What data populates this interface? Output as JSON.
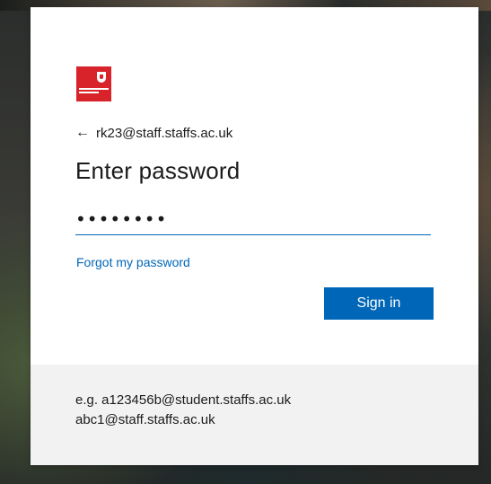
{
  "signin": {
    "identity": "rk23@staff.staffs.ac.uk",
    "title": "Enter password",
    "password_mask": "••••••••",
    "forgot_link": "Forgot my password",
    "submit_label": "Sign in"
  },
  "footer": {
    "hint_line1": "e.g. a123456b@student.staffs.ac.uk",
    "hint_line2": "abc1@staff.staffs.ac.uk"
  },
  "colors": {
    "accent": "#0067b8",
    "brand": "#d8232a",
    "footer_bg": "#f2f2f2"
  },
  "icons": {
    "back": "back-arrow-icon",
    "logo": "staffordshire-university-logo"
  }
}
